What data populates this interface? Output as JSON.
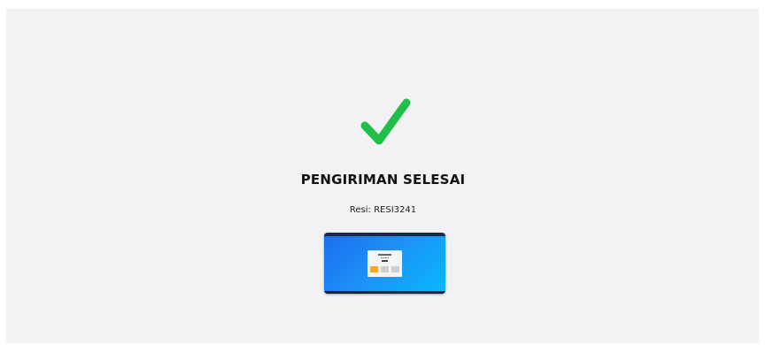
{
  "status": {
    "title": "PENGIRIMAN SELESAI",
    "receipt": "Resi: RESI3241",
    "icon": "checkmark-icon",
    "accent_color": "#1fbf4a"
  },
  "thumbnail": {
    "icon": "screenshot-thumbnail"
  }
}
